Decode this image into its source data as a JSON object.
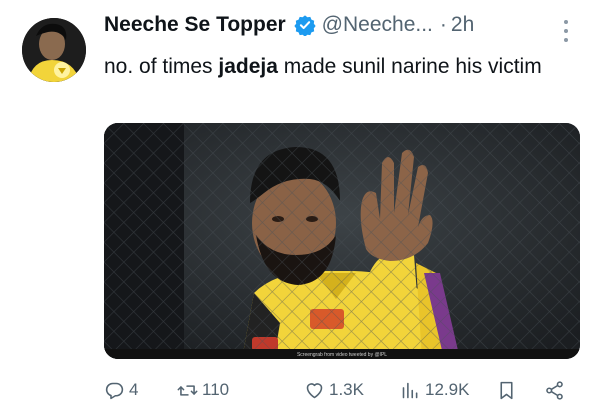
{
  "tweet": {
    "author_name": "Neeche Se Topper",
    "handle": "@Neeche...",
    "dot": "·",
    "time": "2h",
    "text_parts": [
      "no. of times ",
      "jadeja",
      " made sunil narine his victim"
    ]
  },
  "media": {
    "caption": "Screengrab from video tweeted by @IPL"
  },
  "actions": {
    "replies": "4",
    "retweets": "110",
    "likes": "1.3K",
    "views": "12.9K"
  },
  "icons": {
    "verified": "verified-badge-icon",
    "reply": "reply-icon",
    "retweet": "retweet-icon",
    "like": "heart-icon",
    "views": "views-icon",
    "bookmark": "bookmark-icon",
    "share": "share-icon",
    "more": "more-icon"
  },
  "colors": {
    "text": "#0f1419",
    "secondary": "#536471",
    "verified": "#1d9bf0",
    "jersey": "#f2d43a"
  }
}
